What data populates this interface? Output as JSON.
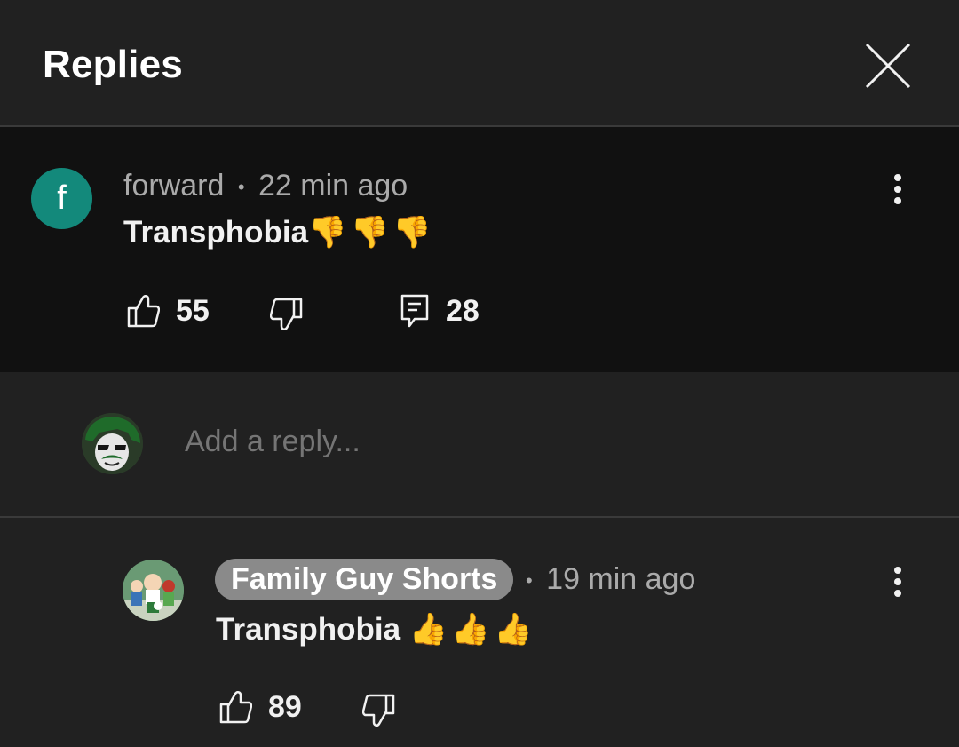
{
  "header": {
    "title": "Replies"
  },
  "comment": {
    "author_initial": "f",
    "author": "forward",
    "separator": "•",
    "time": "22 min ago",
    "text": "Transphobia",
    "emojis": "👎👎👎",
    "likes": "55",
    "replies": "28"
  },
  "reply_box": {
    "placeholder": "Add a reply..."
  },
  "reply": {
    "author": "Family Guy Shorts",
    "separator": "•",
    "time": "19 min ago",
    "text": "Transphobia",
    "emojis": "👍👍👍",
    "likes": "89"
  },
  "colors": {
    "background": "#212121",
    "comment_bg": "#111111",
    "avatar_f": "#13897b",
    "author_chip": "#8a8a8a",
    "muted_text": "#aaaaaa"
  },
  "icons": [
    "close-icon",
    "more-vert-icon",
    "thumb-up-icon",
    "thumb-down-icon",
    "reply-icon"
  ]
}
